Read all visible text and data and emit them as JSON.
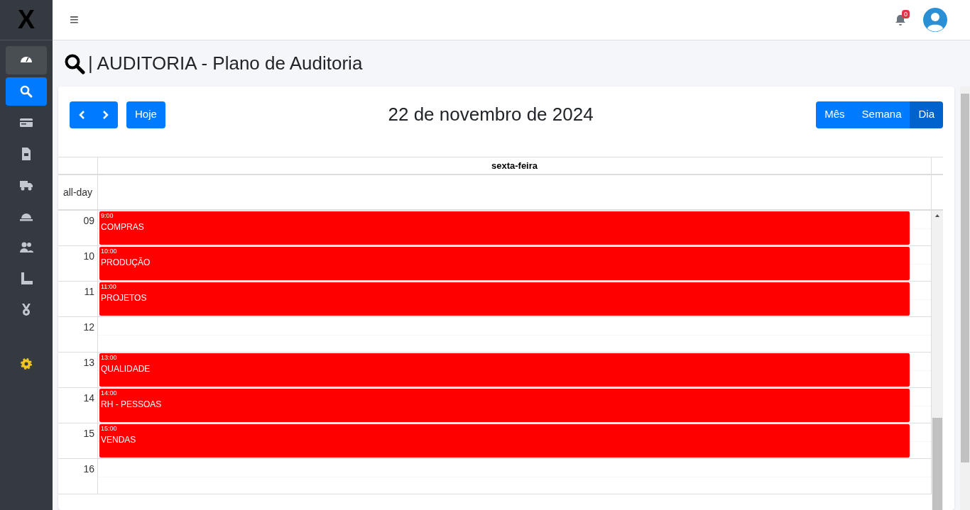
{
  "sidebar": {
    "logo": "X",
    "items": [
      {
        "kind": "dashboard",
        "selected": false
      },
      {
        "kind": "search",
        "selected": true
      },
      {
        "kind": "card",
        "selected": false
      },
      {
        "kind": "document",
        "selected": false
      },
      {
        "kind": "truck",
        "selected": false
      },
      {
        "kind": "helmet",
        "selected": false
      },
      {
        "kind": "users",
        "selected": false
      },
      {
        "kind": "ruler",
        "selected": false
      },
      {
        "kind": "medal",
        "selected": false
      },
      {
        "kind": "settings",
        "selected": false
      }
    ]
  },
  "topbar": {
    "menu": "≡",
    "notifications": "0"
  },
  "page_title": "| AUDITORIA - Plano de Auditoria",
  "toolbar": {
    "today": "Hoje",
    "date": "22 de novembro de 2024",
    "views": [
      {
        "label": "Mês",
        "selected": false
      },
      {
        "label": "Semana",
        "selected": false
      },
      {
        "label": "Dia",
        "selected": true
      }
    ]
  },
  "calendar": {
    "day_header": "sexta-feira",
    "all_day": "all-day",
    "hours": [
      {
        "label": "09",
        "event": {
          "time": "9:00",
          "title": "COMPRAS"
        }
      },
      {
        "label": "10",
        "event": {
          "time": "10:00",
          "title": "PRODUÇÃO"
        }
      },
      {
        "label": "11",
        "event": {
          "time": "11:00",
          "title": "PROJETOS"
        }
      },
      {
        "label": "12"
      },
      {
        "label": "13",
        "event": {
          "time": "13:00",
          "title": "QUALIDADE"
        }
      },
      {
        "label": "14",
        "event": {
          "time": "14:00",
          "title": "RH - PESSOAS"
        }
      },
      {
        "label": "15",
        "event": {
          "time": "15:00",
          "title": "VENDAS"
        }
      },
      {
        "label": "16"
      }
    ]
  }
}
